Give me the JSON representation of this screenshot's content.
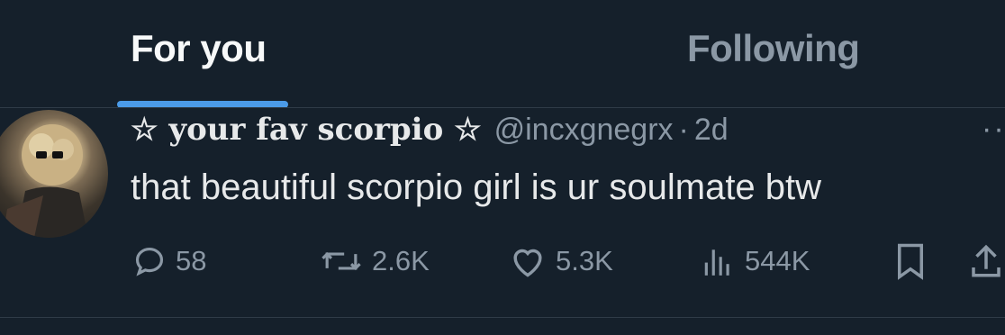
{
  "tabs": {
    "for_you": "For you",
    "following": "Following"
  },
  "tweet": {
    "display_name": "☆ your fav scorpio ☆",
    "handle": "@incxgnegrx",
    "separator": "·",
    "time": "2d",
    "more": "··",
    "text": "that beautiful scorpio girl is ur soulmate btw",
    "actions": {
      "replies": "58",
      "reposts": "2.6K",
      "likes": "5.3K",
      "views": "544K"
    }
  },
  "colors": {
    "background": "#15202b",
    "accent": "#4b9be8",
    "muted": "#8b98a5",
    "text": "#e7e9ea"
  },
  "icons": [
    "reply-icon",
    "repost-icon",
    "like-icon",
    "views-icon",
    "bookmark-icon",
    "share-icon",
    "more-icon"
  ]
}
